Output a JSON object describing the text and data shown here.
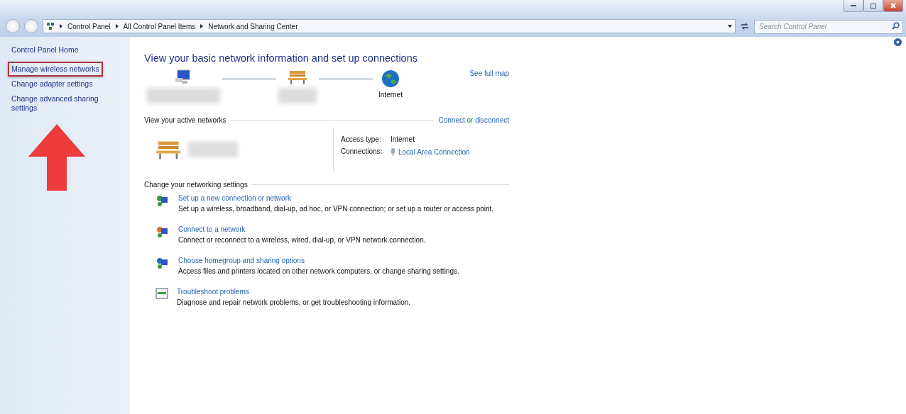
{
  "address_bar": {
    "crumbs": [
      "Control Panel",
      "All Control Panel Items",
      "Network and Sharing Center"
    ]
  },
  "search": {
    "placeholder": "Search Control Panel"
  },
  "sidebar": {
    "items": [
      {
        "label": "Control Panel Home",
        "highlighted": false
      },
      {
        "label": "Manage wireless networks",
        "highlighted": true
      },
      {
        "label": "Change adapter settings",
        "highlighted": false
      },
      {
        "label": "Change advanced sharing settings",
        "highlighted": false
      }
    ]
  },
  "main": {
    "title": "View your basic network information and set up connections",
    "map": {
      "nodes": [
        {
          "kind": "computer"
        },
        {
          "kind": "network"
        },
        {
          "kind": "internet",
          "label": "Internet"
        }
      ],
      "see_full_map": "See full map"
    },
    "active_networks": {
      "heading": "View your active networks",
      "link": "Connect or disconnect",
      "details": [
        {
          "label": "Access type:",
          "value": "Internet",
          "kind": "text"
        },
        {
          "label": "Connections:",
          "value": "Local Area Connection",
          "kind": "link"
        }
      ]
    },
    "settings": {
      "heading": "Change your networking settings",
      "tasks": [
        {
          "kind": "setup",
          "title": "Set up a new connection or network",
          "description": "Set up a wireless, broadband, dial-up, ad hoc, or VPN connection; or set up a router or access point."
        },
        {
          "kind": "connect",
          "title": "Connect to a network",
          "description": "Connect or reconnect to a wireless, wired, dial-up, or VPN network connection."
        },
        {
          "kind": "homegroup",
          "title": "Choose homegroup and sharing options",
          "description": "Access files and printers located on other network computers, or change sharing settings."
        },
        {
          "kind": "troubleshoot",
          "title": "Troubleshoot problems",
          "description": "Diagnose and repair network problems, or get troubleshooting information."
        }
      ]
    }
  }
}
